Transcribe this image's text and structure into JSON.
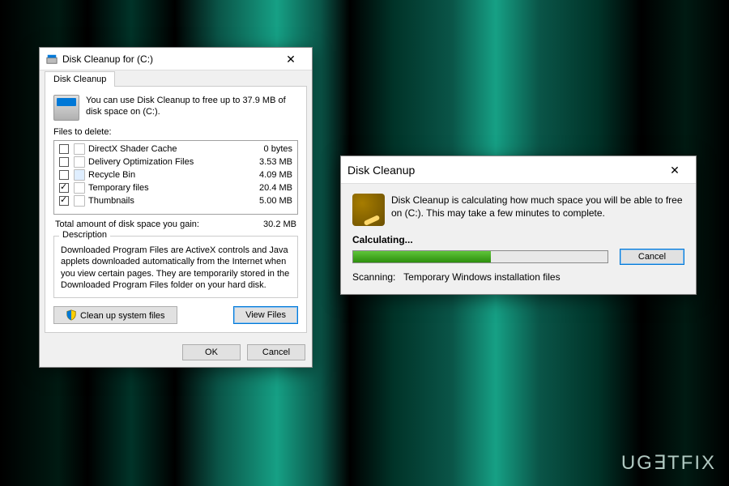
{
  "dlg1": {
    "title": "Disk Cleanup for  (C:)",
    "tab": "Disk Cleanup",
    "info": "You can use Disk Cleanup to free up to 37.9 MB of disk space on  (C:).",
    "files_label": "Files to delete:",
    "items": [
      {
        "checked": false,
        "name": "DirectX Shader Cache",
        "size": "0 bytes"
      },
      {
        "checked": false,
        "name": "Delivery Optimization Files",
        "size": "3.53 MB"
      },
      {
        "checked": false,
        "name": "Recycle Bin",
        "size": "4.09 MB"
      },
      {
        "checked": true,
        "name": "Temporary files",
        "size": "20.4 MB"
      },
      {
        "checked": true,
        "name": "Thumbnails",
        "size": "5.00 MB"
      }
    ],
    "total_label": "Total amount of disk space you gain:",
    "total_value": "30.2 MB",
    "desc_legend": "Description",
    "desc_text": "Downloaded Program Files are ActiveX controls and Java applets downloaded automatically from the Internet when you view certain pages. They are temporarily stored in the Downloaded Program Files folder on your hard disk.",
    "cleanup_sysfiles": "Clean up system files",
    "view_files": "View Files",
    "ok": "OK",
    "cancel": "Cancel"
  },
  "dlg2": {
    "title": "Disk Cleanup",
    "info": "Disk Cleanup is calculating how much space you will be able to free on  (C:). This may take a few minutes to complete.",
    "calculating": "Calculating...",
    "cancel": "Cancel",
    "scanning_label": "Scanning:",
    "scanning_target": "Temporary Windows installation files"
  },
  "watermark": "UG∃TFIX"
}
